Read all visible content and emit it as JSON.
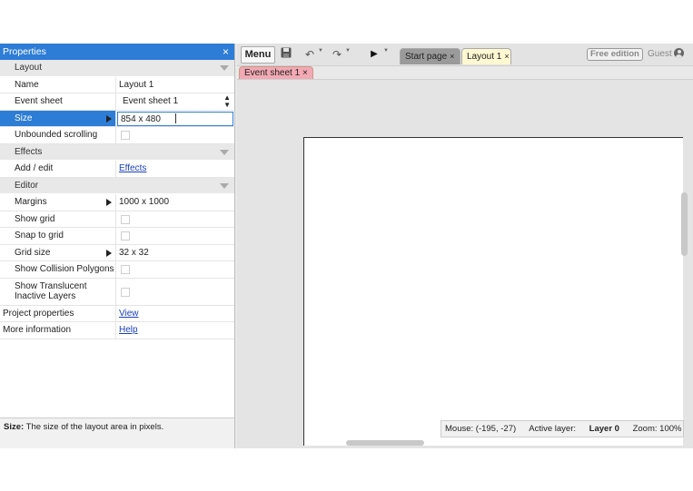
{
  "properties": {
    "title": "Properties",
    "close": "×",
    "sections": {
      "layout": "Layout",
      "effects": "Effects",
      "editor": "Editor"
    },
    "rows": {
      "name": {
        "label": "Name",
        "value": "Layout 1"
      },
      "event_sheet": {
        "label": "Event sheet",
        "value": "Event sheet 1",
        "arrows": "▲▼"
      },
      "size": {
        "label": "Size",
        "value": "854 x 480"
      },
      "unbounded": {
        "label": "Unbounded scrolling"
      },
      "add_edit": {
        "label": "Add / edit",
        "value": "Effects"
      },
      "margins": {
        "label": "Margins",
        "value": "1000 x 1000"
      },
      "show_grid": {
        "label": "Show grid"
      },
      "snap_grid": {
        "label": "Snap to grid"
      },
      "grid_size": {
        "label": "Grid size",
        "value": "32 x 32"
      },
      "show_collision": {
        "label": "Show Collision Polygons"
      },
      "show_translucent": {
        "label": "Show Translucent Inactive Layers"
      },
      "project_props": {
        "label": "Project properties",
        "value": "View"
      },
      "more_info": {
        "label": "More information",
        "value": "Help"
      }
    },
    "help": {
      "term": "Size:",
      "text": "The size of the layout area in pixels."
    }
  },
  "toolbar": {
    "menu": "Menu",
    "save_icon": "💾",
    "undo_icon": "↶",
    "redo_icon": "↷",
    "run_icon": "▶",
    "caret": "▼",
    "tabs": [
      {
        "label": "Start page",
        "close": "×"
      },
      {
        "label": "Layout 1",
        "close": "×"
      }
    ],
    "free_edition": "Free edition",
    "guest": "Guest"
  },
  "subtab": {
    "label": "Event sheet 1",
    "close": "×"
  },
  "status": {
    "mouse": "Mouse: (-195, -27)",
    "active_layer_label": "Active layer:",
    "active_layer": "Layer 0",
    "zoom": "Zoom: 100%"
  }
}
